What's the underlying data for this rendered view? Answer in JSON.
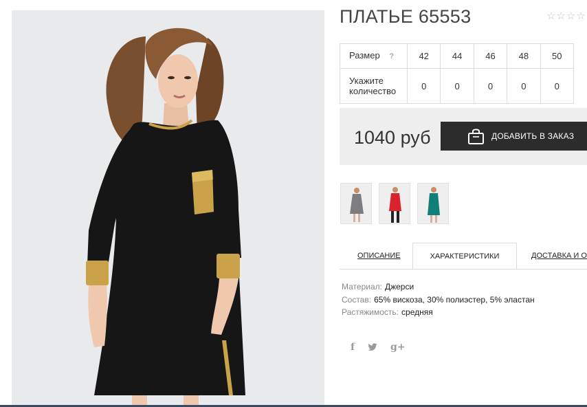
{
  "product": {
    "title": "ПЛАТЬЕ 65553",
    "rating": {
      "value": 0,
      "max": 5,
      "star_glyph": "☆"
    }
  },
  "size_table": {
    "size_label": "Размер",
    "help_glyph": "?",
    "sizes": [
      "42",
      "44",
      "46",
      "48",
      "50"
    ],
    "quantity_label_line1": "Укажите",
    "quantity_label_line2": "количество",
    "quantities": [
      "0",
      "0",
      "0",
      "0",
      "0"
    ]
  },
  "purchase": {
    "price": "1040 руб",
    "order_button_label": "ДОБАВИТЬ В ЗАКАЗ",
    "order_button_icon": "shopping-bag-icon"
  },
  "thumbnails": [
    {
      "name": "thumbnail-grey-dress",
      "dress_color": "#7d7d80"
    },
    {
      "name": "thumbnail-red-dress",
      "dress_color": "#d8222c"
    },
    {
      "name": "thumbnail-teal-dress",
      "dress_color": "#0f7f78"
    }
  ],
  "tabs": [
    {
      "label": "ОПИСАНИЕ",
      "active": false
    },
    {
      "label": "ХАРАКТЕРИСТИКИ",
      "active": true
    },
    {
      "label": "ДОСТАВКА И ОПЛАТА",
      "active": false
    }
  ],
  "specs": [
    {
      "key": "Материал:",
      "value": "Джерси"
    },
    {
      "key": "Состав:",
      "value": "65% вискоза, 30% полиэстер, 5% эластан"
    },
    {
      "key": "Растяжимость:",
      "value": "средняя"
    }
  ],
  "social": {
    "facebook_glyph": "f",
    "twitter_icon": "twitter-bird-icon",
    "google_plus_glyph": "g+"
  },
  "colors": {
    "dress_main": "#161616",
    "gold_trim": "#c9a24a",
    "button_bg": "#2c2c2c",
    "price_box_bg": "#eeeeee",
    "photo_bg": "#e9eaec"
  }
}
